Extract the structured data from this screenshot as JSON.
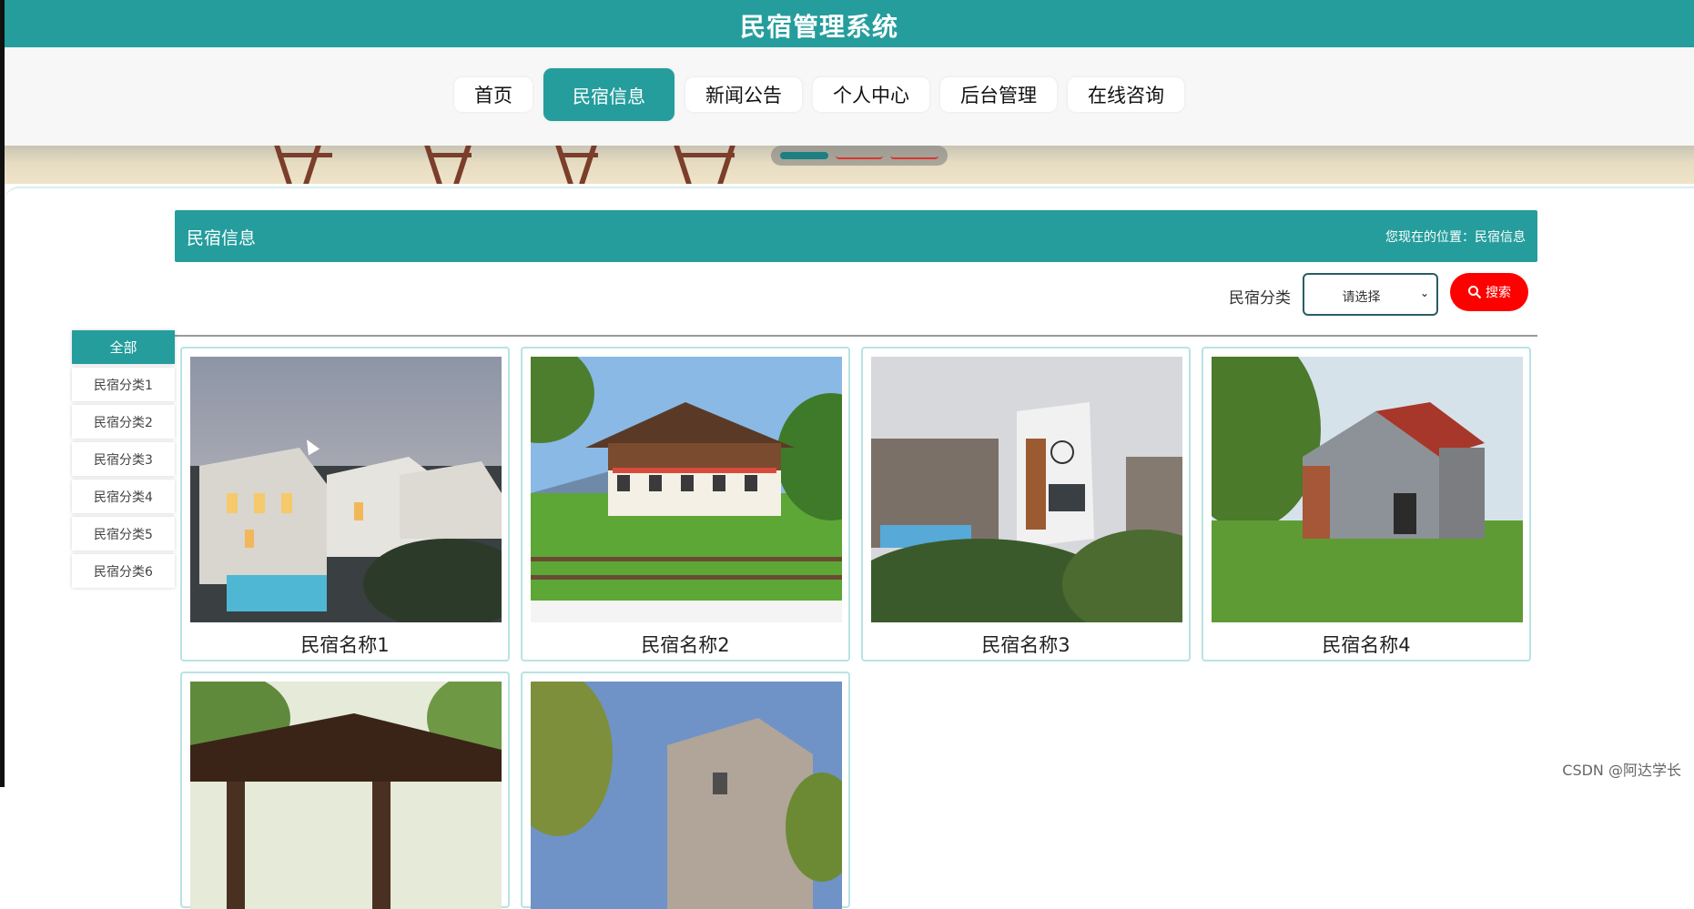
{
  "header": {
    "title": "民宿管理系统"
  },
  "nav": {
    "items": [
      {
        "label": "首页",
        "active": false
      },
      {
        "label": "民宿信息",
        "active": true
      },
      {
        "label": "新闻公告",
        "active": false
      },
      {
        "label": "个人中心",
        "active": false
      },
      {
        "label": "后台管理",
        "active": false
      },
      {
        "label": "在线咨询",
        "active": false
      }
    ]
  },
  "section": {
    "title": "民宿信息",
    "breadcrumb": "您现在的位置：民宿信息"
  },
  "filter": {
    "label": "民宿分类",
    "select_value": "请选择",
    "search_label": "搜索"
  },
  "categories": [
    "全部",
    "民宿分类1",
    "民宿分类2",
    "民宿分类3",
    "民宿分类4",
    "民宿分类5",
    "民宿分类6"
  ],
  "listings": [
    {
      "name": "民宿名称1"
    },
    {
      "name": "民宿名称2"
    },
    {
      "name": "民宿名称3"
    },
    {
      "name": "民宿名称4"
    },
    {
      "name": ""
    },
    {
      "name": ""
    }
  ],
  "watermark": "CSDN @阿达学长",
  "colors": {
    "primary": "#259d9d",
    "search": "#ff0000"
  }
}
